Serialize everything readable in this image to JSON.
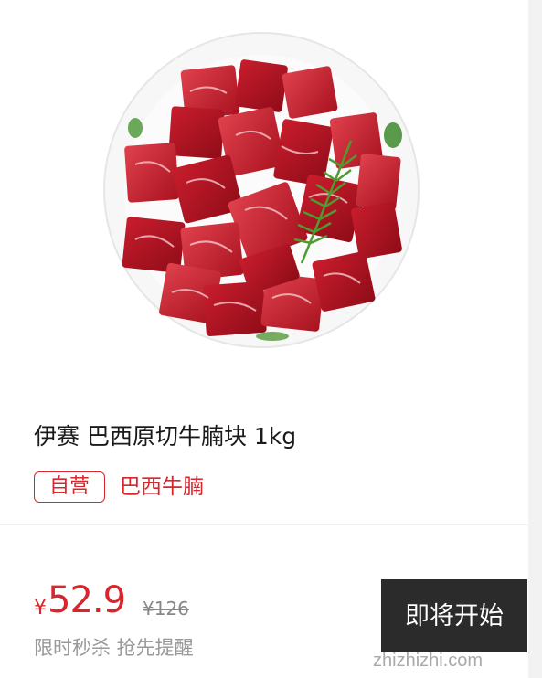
{
  "product": {
    "title": "伊赛 巴西原切牛腩块 1kg",
    "self_operated_tag": "自营",
    "tag": "巴西牛腩"
  },
  "pricing": {
    "currency": "¥",
    "price": "52.9",
    "original_price": "¥126",
    "note": "限时秒杀 抢先提醒"
  },
  "cta": {
    "label": "即将开始"
  },
  "watermark": "zhizhizhi.com",
  "colors": {
    "accent": "#d7262e",
    "button_bg": "#2b2b2b"
  }
}
